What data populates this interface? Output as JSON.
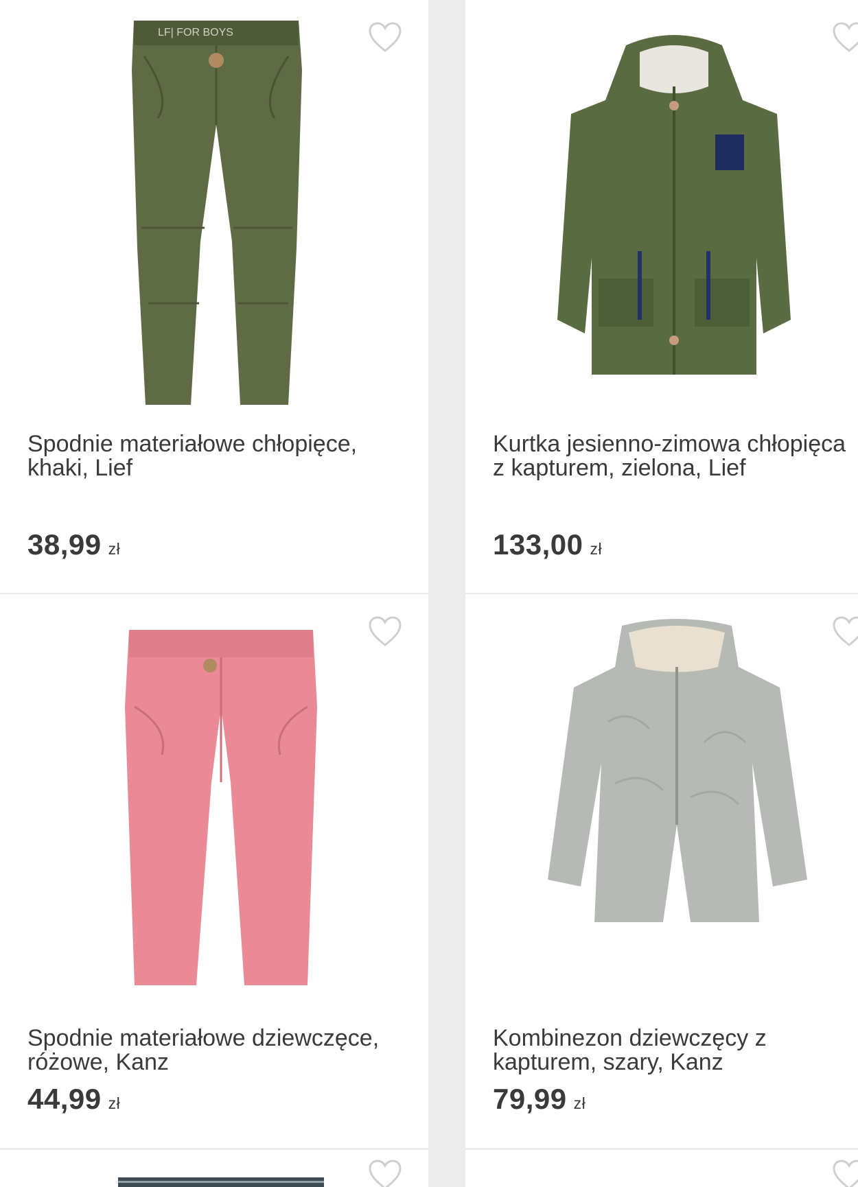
{
  "currency": "zł",
  "products": [
    {
      "title": "Spodnie materiałowe chłopięce, khaki, Lief",
      "price": "38,99",
      "icon": "khaki-trousers"
    },
    {
      "title": "Kurtka jesienno-zimowa chłopięca z kapturem, zielona, Lief",
      "price": "133,00",
      "icon": "green-parka"
    },
    {
      "title": "Spodnie materiałowe dziewczęce, różowe, Kanz",
      "price": "44,99",
      "icon": "pink-trousers"
    },
    {
      "title": "Kombinezon dziewczęcy z kapturem, szary, Kanz",
      "price": "79,99",
      "icon": "grey-snowsuit"
    }
  ]
}
